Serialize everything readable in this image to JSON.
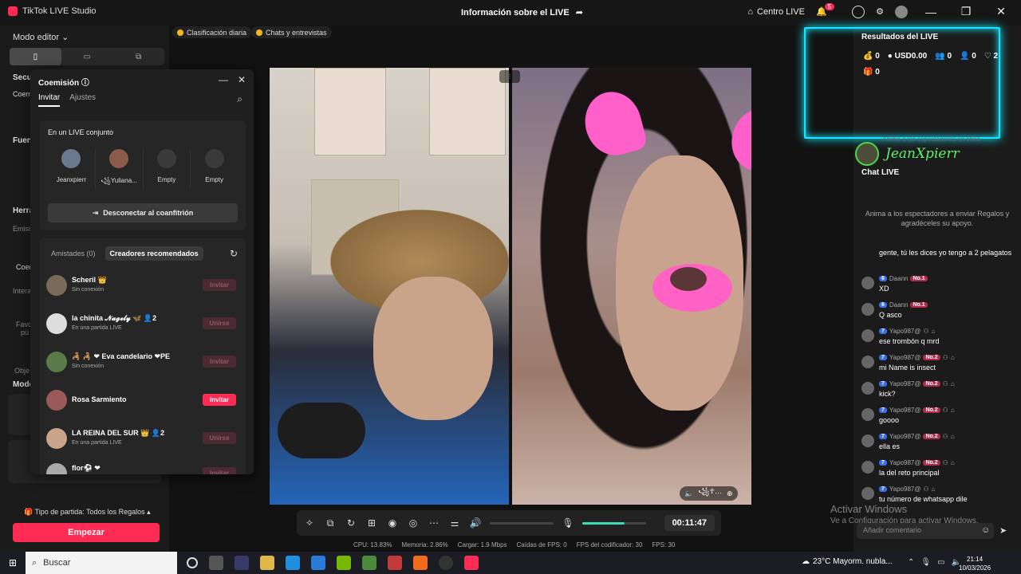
{
  "app": {
    "title": "TikTok LIVE Studio",
    "center_title": "Información sobre el LIVE",
    "centro_live": "Centro LIVE",
    "notif_count": "5"
  },
  "leftbar": {
    "mode": "Modo editor",
    "labels": [
      "Secu",
      "Coem",
      "Fuent",
      "Herra",
      "Emisi",
      "Coem",
      "Intera",
      "Model"
    ],
    "muted": [
      "Favo",
      "pú",
      "Obje"
    ],
    "match_type": "Tipo de partida: Todos los Regalos",
    "start_button": "Empezar"
  },
  "pills": [
    "Clasificación diaria",
    "Chats y entrevistas"
  ],
  "popup": {
    "title": "Coemisión",
    "tabs": [
      "Invitar",
      "Ajustes"
    ],
    "joint_title": "En un LIVE conjunto",
    "slots": [
      {
        "name": "Jeanxpierr",
        "empty": false
      },
      {
        "name": "꧁Yuliana...",
        "empty": false
      },
      {
        "name": "Empty",
        "empty": true
      },
      {
        "name": "Empty",
        "empty": true
      }
    ],
    "disconnect": "Desconectar al coanfitrión",
    "rec_tabs": [
      "Amistades (0)",
      "Creadores recomendados"
    ],
    "friends": [
      {
        "name": "Scheril 👑",
        "sub": "Sin conexión",
        "btn": "Invitar",
        "on": false
      },
      {
        "name": "la chinita 𝓝𝓪𝓰𝓮𝓵𝔂 🦋  👤2",
        "sub": "En una partida LIVE",
        "btn": "Unirse",
        "on": false
      },
      {
        "name": "🦂 🦂 ❤ Eva candelario ❤PE",
        "sub": "Sin conexión",
        "btn": "Invitar",
        "on": false
      },
      {
        "name": "Rosa Sarmiento",
        "sub": "",
        "btn": "Invitar",
        "on": true
      },
      {
        "name": "LA REINA DEL SUR 👑  👤2",
        "sub": "En una partida LIVE",
        "btn": "Unirse",
        "on": false
      },
      {
        "name": "flor⚽ ❤",
        "sub": "",
        "btn": "Invitar",
        "on": false
      }
    ]
  },
  "video": {
    "guest_label": "꧁☥…"
  },
  "controls": {
    "timer": "00:11:47",
    "volume_level": 0,
    "mic_level": 0.66
  },
  "stats": [
    "CPU: 13.83%",
    "Memoria: 2.86%",
    "Cargar: 1.9 Mbps",
    "Caídas de FPS: 0",
    "FPS del codificador: 30",
    "FPS: 30"
  ],
  "results": {
    "title": "Resultados del LIVE",
    "coins": "0",
    "usd": "USD0.00",
    "viewers": "0",
    "new_followers": "0",
    "likes": "2",
    "gifts": "0",
    "watermark": "Anima a los espectadores en línea"
  },
  "streamer": "JeanXpierr",
  "chat": {
    "title": "Chat LIVE",
    "empty_text": "Anima a los espectadores a enviar Regalos y agradéceles su apoyo.",
    "messages": [
      {
        "user": "",
        "level": "",
        "rank": "",
        "text": "gente, tú les dices yo tengo a 2 pelagatos"
      },
      {
        "user": "Daann",
        "level": "6",
        "rank": "No.1",
        "text": "XD"
      },
      {
        "user": "Daann",
        "level": "6",
        "rank": "No.1",
        "text": "Q asco"
      },
      {
        "user": "Yapo987@",
        "level": "7",
        "rank": "",
        "text": "ese trombón q mrd"
      },
      {
        "user": "Yapo987@",
        "level": "7",
        "rank": "No.2",
        "text": "mi Name is insect"
      },
      {
        "user": "Yapo987@",
        "level": "7",
        "rank": "No.2",
        "text": "kick?"
      },
      {
        "user": "Yapo987@",
        "level": "7",
        "rank": "No.2",
        "text": "goooo"
      },
      {
        "user": "Yapo987@",
        "level": "7",
        "rank": "No.2",
        "text": "ella es"
      },
      {
        "user": "Yapo987@",
        "level": "7",
        "rank": "No.2",
        "text": "la del reto principal"
      },
      {
        "user": "Yapo987@",
        "level": "7",
        "rank": "",
        "text": "tu número de whatsapp dile"
      }
    ],
    "placeholder": "Añadir comentario"
  },
  "activate": {
    "line1": "Activar Windows",
    "line2": "Ve a Configuración para activar Windows."
  },
  "taskbar": {
    "search": "Buscar",
    "weather": "23°C  Mayorm. nubla...",
    "time": "21:14",
    "date": "10/03/2026"
  },
  "colors": {
    "accent": "#fe2c55",
    "neon": "#16e6ff",
    "mic_fill": "#3ddbb7",
    "streamer_name": "#5ef06a"
  }
}
